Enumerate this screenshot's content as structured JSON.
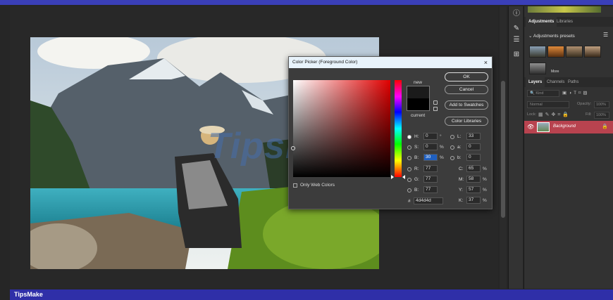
{
  "dialog": {
    "title": "Color Picker (Foreground Color)",
    "close_glyph": "×",
    "new_label": "new",
    "current_label": "current",
    "ok": "OK",
    "cancel": "Cancel",
    "add_to_swatches": "Add to Swatches",
    "color_libraries": "Color Libraries",
    "only_web_colors": "Only Web Colors",
    "hsb": {
      "h_label": "H:",
      "h": "0",
      "h_unit": "°",
      "s_label": "S:",
      "s": "0",
      "s_unit": "%",
      "b_label": "B:",
      "b": "30",
      "b_unit": "%"
    },
    "rgb": {
      "r_label": "R:",
      "r": "77",
      "g_label": "G:",
      "g": "77",
      "b_label": "B:",
      "b": "77"
    },
    "lab": {
      "l_label": "L:",
      "l": "33",
      "a_label": "a:",
      "a": "0",
      "b_label": "b:",
      "b": "0"
    },
    "cmyk": {
      "c_label": "C:",
      "c": "65",
      "m_label": "M:",
      "m": "58",
      "y_label": "Y:",
      "y": "57",
      "k_label": "K:",
      "k": "37",
      "unit": "%"
    },
    "hex_label": "#",
    "hex": "4d4d4d"
  },
  "right_panel": {
    "tab_adjustments": "Adjustments",
    "tab_libraries": "Libraries",
    "presets_heading": "Adjustments presets",
    "more": "More",
    "tab_layers": "Layers",
    "tab_channels": "Channels",
    "tab_paths": "Paths",
    "search_placeholder": "Kind",
    "blend_mode": "Normal",
    "opacity_label": "Opacity:",
    "opacity": "100%",
    "lock_label": "Lock:",
    "fill_label": "Fill:",
    "fill": "100%",
    "layer_name": "Background"
  },
  "watermark": "TipsMake",
  "footer_brand": "TipsMake",
  "colors": {
    "foreground": "#4d4d4d",
    "accent": "#3a3fb8",
    "layer_selected": "#b8434f"
  }
}
